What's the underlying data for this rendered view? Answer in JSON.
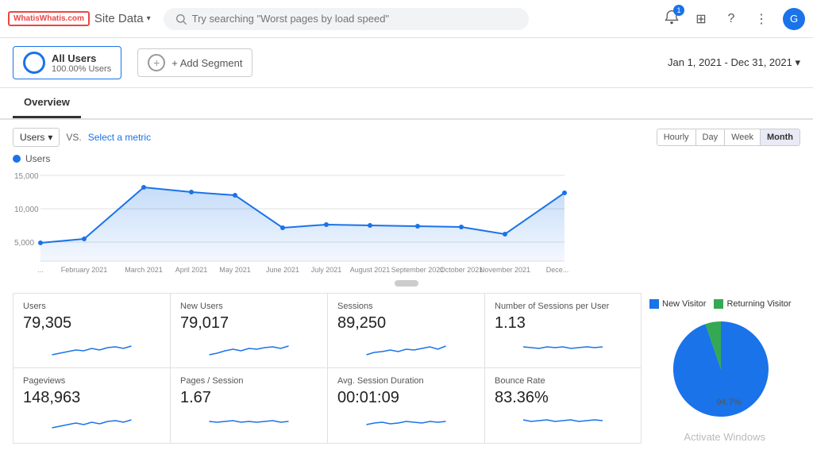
{
  "header": {
    "logo_text": "WhatisWhatis.com",
    "site_data_label": "Site Data",
    "search_placeholder": "Try searching \"Worst pages by load speed\"",
    "notif_count": "1"
  },
  "segment": {
    "all_users_label": "All Users",
    "all_users_sub": "100.00% Users",
    "add_segment_label": "+ Add Segment",
    "date_range": "Jan 1, 2021 - Dec 31, 2021"
  },
  "tab": {
    "overview_label": "Overview"
  },
  "chart": {
    "metric_label": "Users",
    "vs_label": "VS.",
    "select_metric_label": "Select a metric",
    "time_buttons": [
      "Hourly",
      "Day",
      "Week",
      "Month"
    ],
    "active_time": "Month",
    "legend_label": "Users",
    "x_labels": [
      "...",
      "February 2021",
      "March 2021",
      "April 2021",
      "May 2021",
      "June 2021",
      "July 2021",
      "August 2021",
      "September 2021",
      "October 2021",
      "November 2021",
      "Dece..."
    ],
    "y_labels": [
      "15,000",
      "10,000",
      "5,000"
    ]
  },
  "stats": [
    {
      "label": "Users",
      "value": "79,305"
    },
    {
      "label": "New Users",
      "value": "79,017"
    },
    {
      "label": "Sessions",
      "value": "89,250"
    },
    {
      "label": "Number of Sessions per User",
      "value": "1.13"
    },
    {
      "label": "Pageviews",
      "value": "148,963"
    },
    {
      "label": "Pages / Session",
      "value": "1.67"
    },
    {
      "label": "Avg. Session Duration",
      "value": "00:01:09"
    },
    {
      "label": "Bounce Rate",
      "value": "83.36%"
    }
  ],
  "pie": {
    "legend": [
      {
        "label": "New Visitor",
        "color": "#1a73e8"
      },
      {
        "label": "Returning Visitor",
        "color": "#34a853"
      }
    ],
    "new_pct": 94.7,
    "returning_pct": 5.3,
    "pct_label": "94.7%"
  },
  "watermark": {
    "text": "Activate Windows"
  }
}
